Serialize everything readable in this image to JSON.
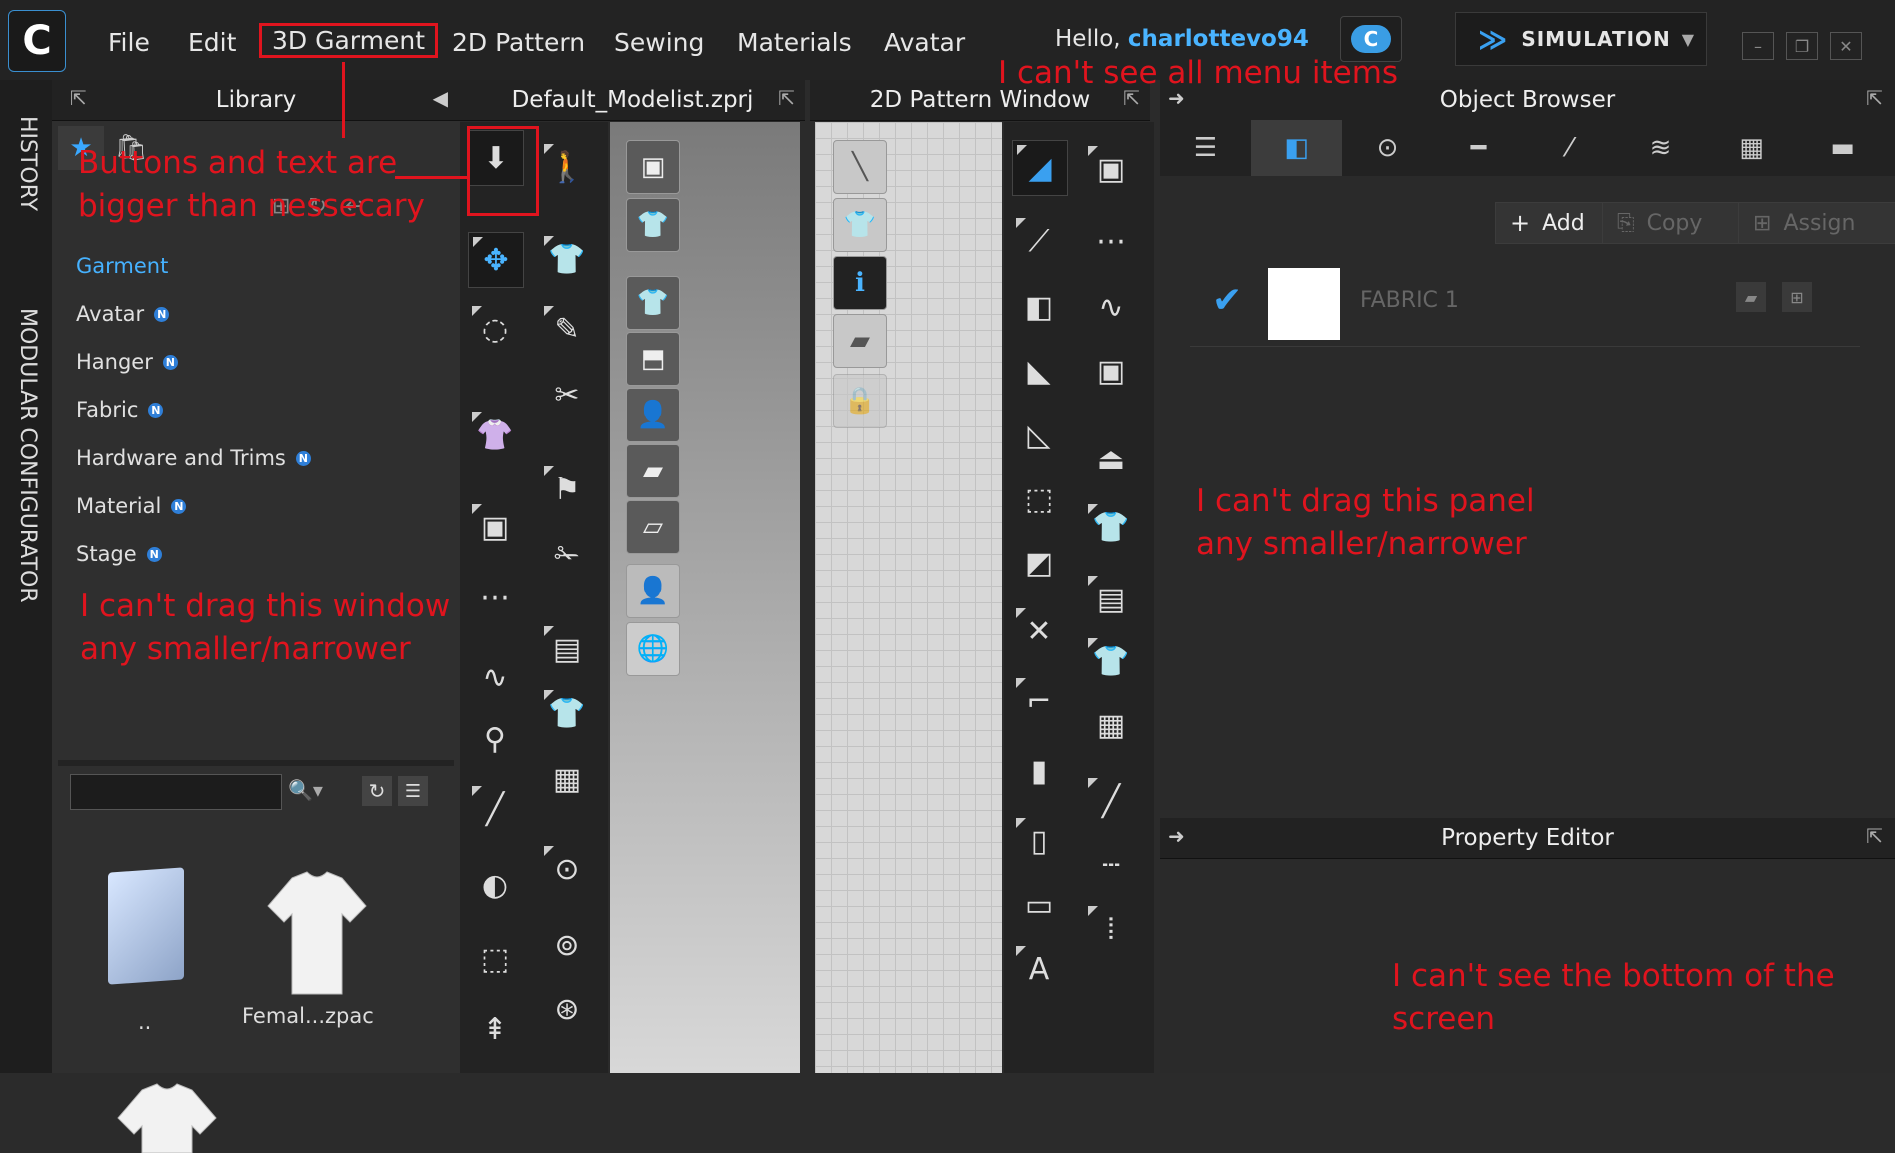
{
  "menubar": {
    "items": [
      "File",
      "Edit",
      "3D Garment",
      "2D Pattern",
      "Sewing",
      "Materials",
      "Avatar"
    ],
    "greeting": "Hello,",
    "username": "charlottevo94",
    "cloud_icon_text": "C",
    "simulation_label": "SIMULATION"
  },
  "sidebar": {
    "history": "HISTORY",
    "modular": "MODULAR CONFIGURATOR"
  },
  "library": {
    "title": "Library",
    "items": [
      {
        "label": "Garment",
        "badge": ""
      },
      {
        "label": "Avatar",
        "badge": "N"
      },
      {
        "label": "Hanger",
        "badge": "N"
      },
      {
        "label": "Fabric",
        "badge": "N"
      },
      {
        "label": "Hardware and Trims",
        "badge": "N"
      },
      {
        "label": "Material",
        "badge": "N"
      },
      {
        "label": "Stage",
        "badge": "N"
      }
    ],
    "thumbs": [
      "..",
      "Femal...zpac"
    ]
  },
  "viewport3d": {
    "title": "Default_Modelist.zprj"
  },
  "pattern2d": {
    "title": "2D Pattern Window"
  },
  "object_browser": {
    "title": "Object Browser",
    "add": "Add",
    "copy": "Copy",
    "assign": "Assign",
    "fabric_name": "FABRIC 1"
  },
  "property_editor": {
    "title": "Property Editor"
  },
  "annotations": {
    "menu": "I can't see all menu items",
    "buttons_1": "Buttons and text are",
    "buttons_2": "bigger than nessecary",
    "window_1": "I can't drag this window",
    "window_2": "any smaller/narrower",
    "panel_1": "I can't drag this panel",
    "panel_2": "any smaller/narrower",
    "bottom_1": "I can't see the bottom of the",
    "bottom_2": "screen"
  },
  "colors": {
    "accent": "#46b2ff",
    "annotation": "#e0141e"
  }
}
